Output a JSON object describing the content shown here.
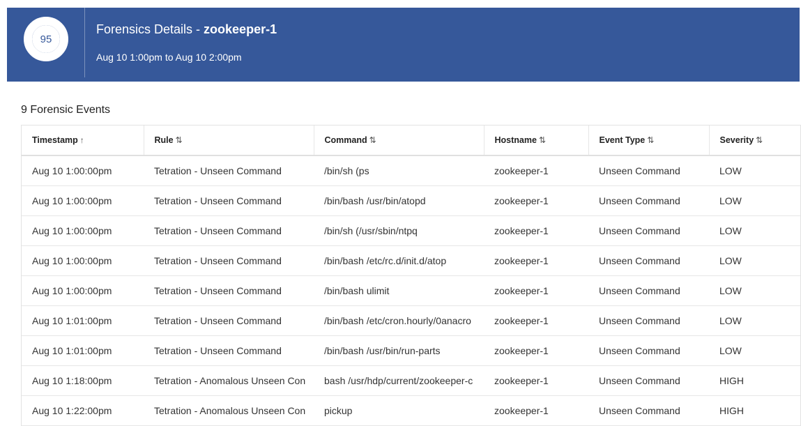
{
  "header": {
    "score": "95",
    "title_prefix": "Forensics Details - ",
    "hostname": "zookeeper-1",
    "time_range": "Aug 10 1:00pm to Aug 10 2:00pm",
    "bg_color": "#36589a"
  },
  "events": {
    "count_label": "9 Forensic Events"
  },
  "table": {
    "columns": [
      {
        "label": "Timestamp",
        "sort_icon": "↑"
      },
      {
        "label": "Rule",
        "sort_icon": "⇅"
      },
      {
        "label": "Command",
        "sort_icon": "⇅"
      },
      {
        "label": "Hostname",
        "sort_icon": "⇅"
      },
      {
        "label": "Event Type",
        "sort_icon": "⇅"
      },
      {
        "label": "Severity",
        "sort_icon": "⇅"
      }
    ],
    "rows": [
      [
        "Aug 10 1:00:00pm",
        "Tetration - Unseen Command",
        "/bin/sh (ps",
        "zookeeper-1",
        "Unseen Command",
        "LOW"
      ],
      [
        "Aug 10 1:00:00pm",
        "Tetration - Unseen Command",
        "/bin/bash /usr/bin/atopd",
        "zookeeper-1",
        "Unseen Command",
        "LOW"
      ],
      [
        "Aug 10 1:00:00pm",
        "Tetration - Unseen Command",
        "/bin/sh (/usr/sbin/ntpq",
        "zookeeper-1",
        "Unseen Command",
        "LOW"
      ],
      [
        "Aug 10 1:00:00pm",
        "Tetration - Unseen Command",
        "/bin/bash /etc/rc.d/init.d/atop",
        "zookeeper-1",
        "Unseen Command",
        "LOW"
      ],
      [
        "Aug 10 1:00:00pm",
        "Tetration - Unseen Command",
        "/bin/bash ulimit",
        "zookeeper-1",
        "Unseen Command",
        "LOW"
      ],
      [
        "Aug 10 1:01:00pm",
        "Tetration - Unseen Command",
        "/bin/bash /etc/cron.hourly/0anacro",
        "zookeeper-1",
        "Unseen Command",
        "LOW"
      ],
      [
        "Aug 10 1:01:00pm",
        "Tetration - Unseen Command",
        "/bin/bash /usr/bin/run-parts",
        "zookeeper-1",
        "Unseen Command",
        "LOW"
      ],
      [
        "Aug 10 1:18:00pm",
        "Tetration - Anomalous Unseen Con",
        "bash /usr/hdp/current/zookeeper-c",
        "zookeeper-1",
        "Unseen Command",
        "HIGH"
      ],
      [
        "Aug 10 1:22:00pm",
        "Tetration - Anomalous Unseen Con",
        "pickup",
        "zookeeper-1",
        "Unseen Command",
        "HIGH"
      ]
    ]
  }
}
